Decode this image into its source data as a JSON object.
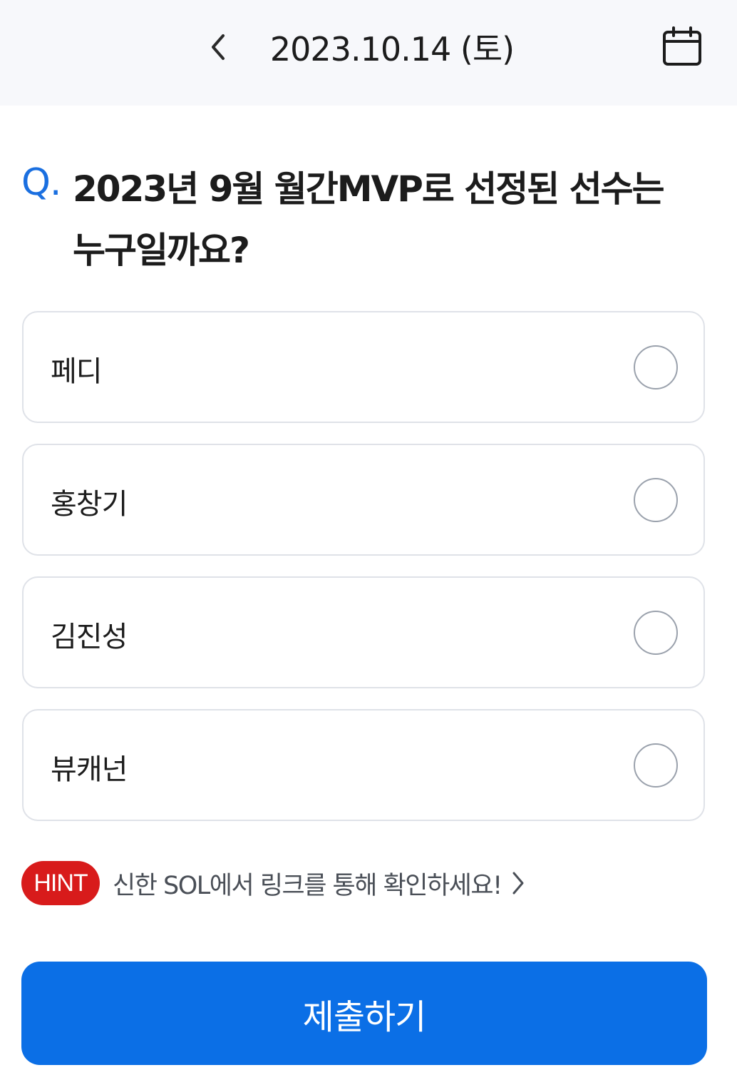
{
  "header": {
    "date": "2023.10.14 (토)",
    "back_icon": "chevron-left-icon",
    "calendar_icon": "calendar-icon"
  },
  "question": {
    "mark": "Q.",
    "line1": "2023년 9월 월간MVP로 선정된 선수는",
    "line2": "누구일까요?"
  },
  "options": [
    {
      "label": "페디",
      "selected": false
    },
    {
      "label": "홍창기",
      "selected": false
    },
    {
      "label": "김진성",
      "selected": false
    },
    {
      "label": "뷰캐넌",
      "selected": false
    }
  ],
  "hint": {
    "badge": "HINT",
    "text": "신한 SOL에서 링크를 통해 확인하세요!",
    "chevron_icon": "chevron-right-icon"
  },
  "submit": {
    "label": "제출하기"
  },
  "colors": {
    "accent": "#1a6fe0",
    "submit_bg": "#0b6fe6",
    "hint_badge": "#d81b1b",
    "header_bg": "#f7f8fb"
  }
}
